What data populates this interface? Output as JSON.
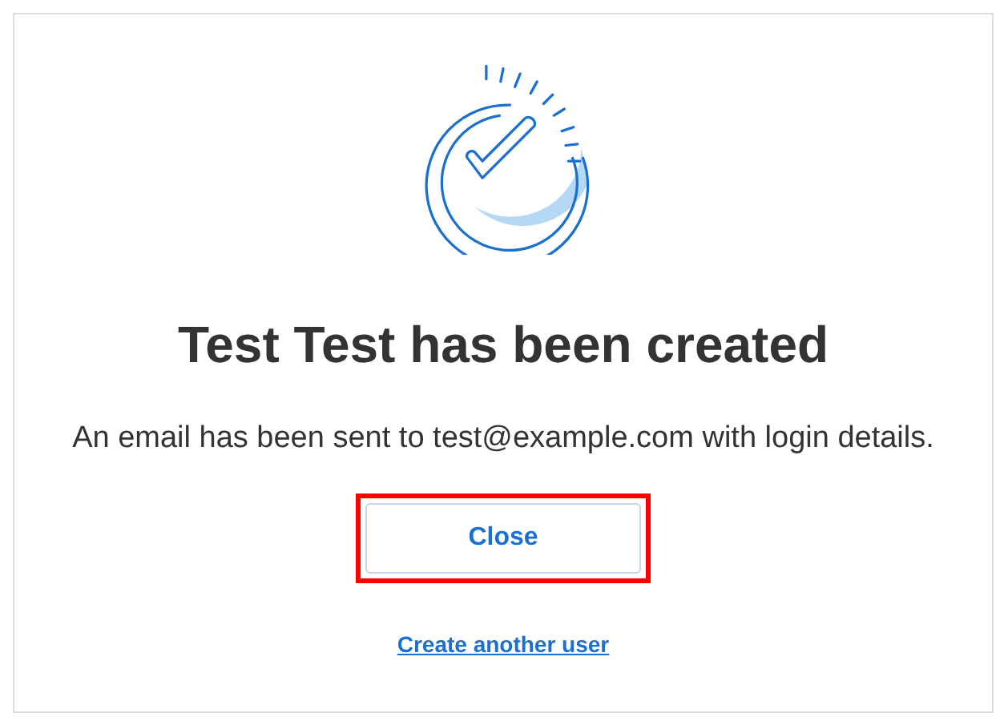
{
  "dialog": {
    "title": "Test Test has been created",
    "message": "An email has been sent to test@example.com with login details.",
    "primary_button": {
      "label": "Close",
      "highlighted": true
    },
    "link": "Create another user"
  }
}
